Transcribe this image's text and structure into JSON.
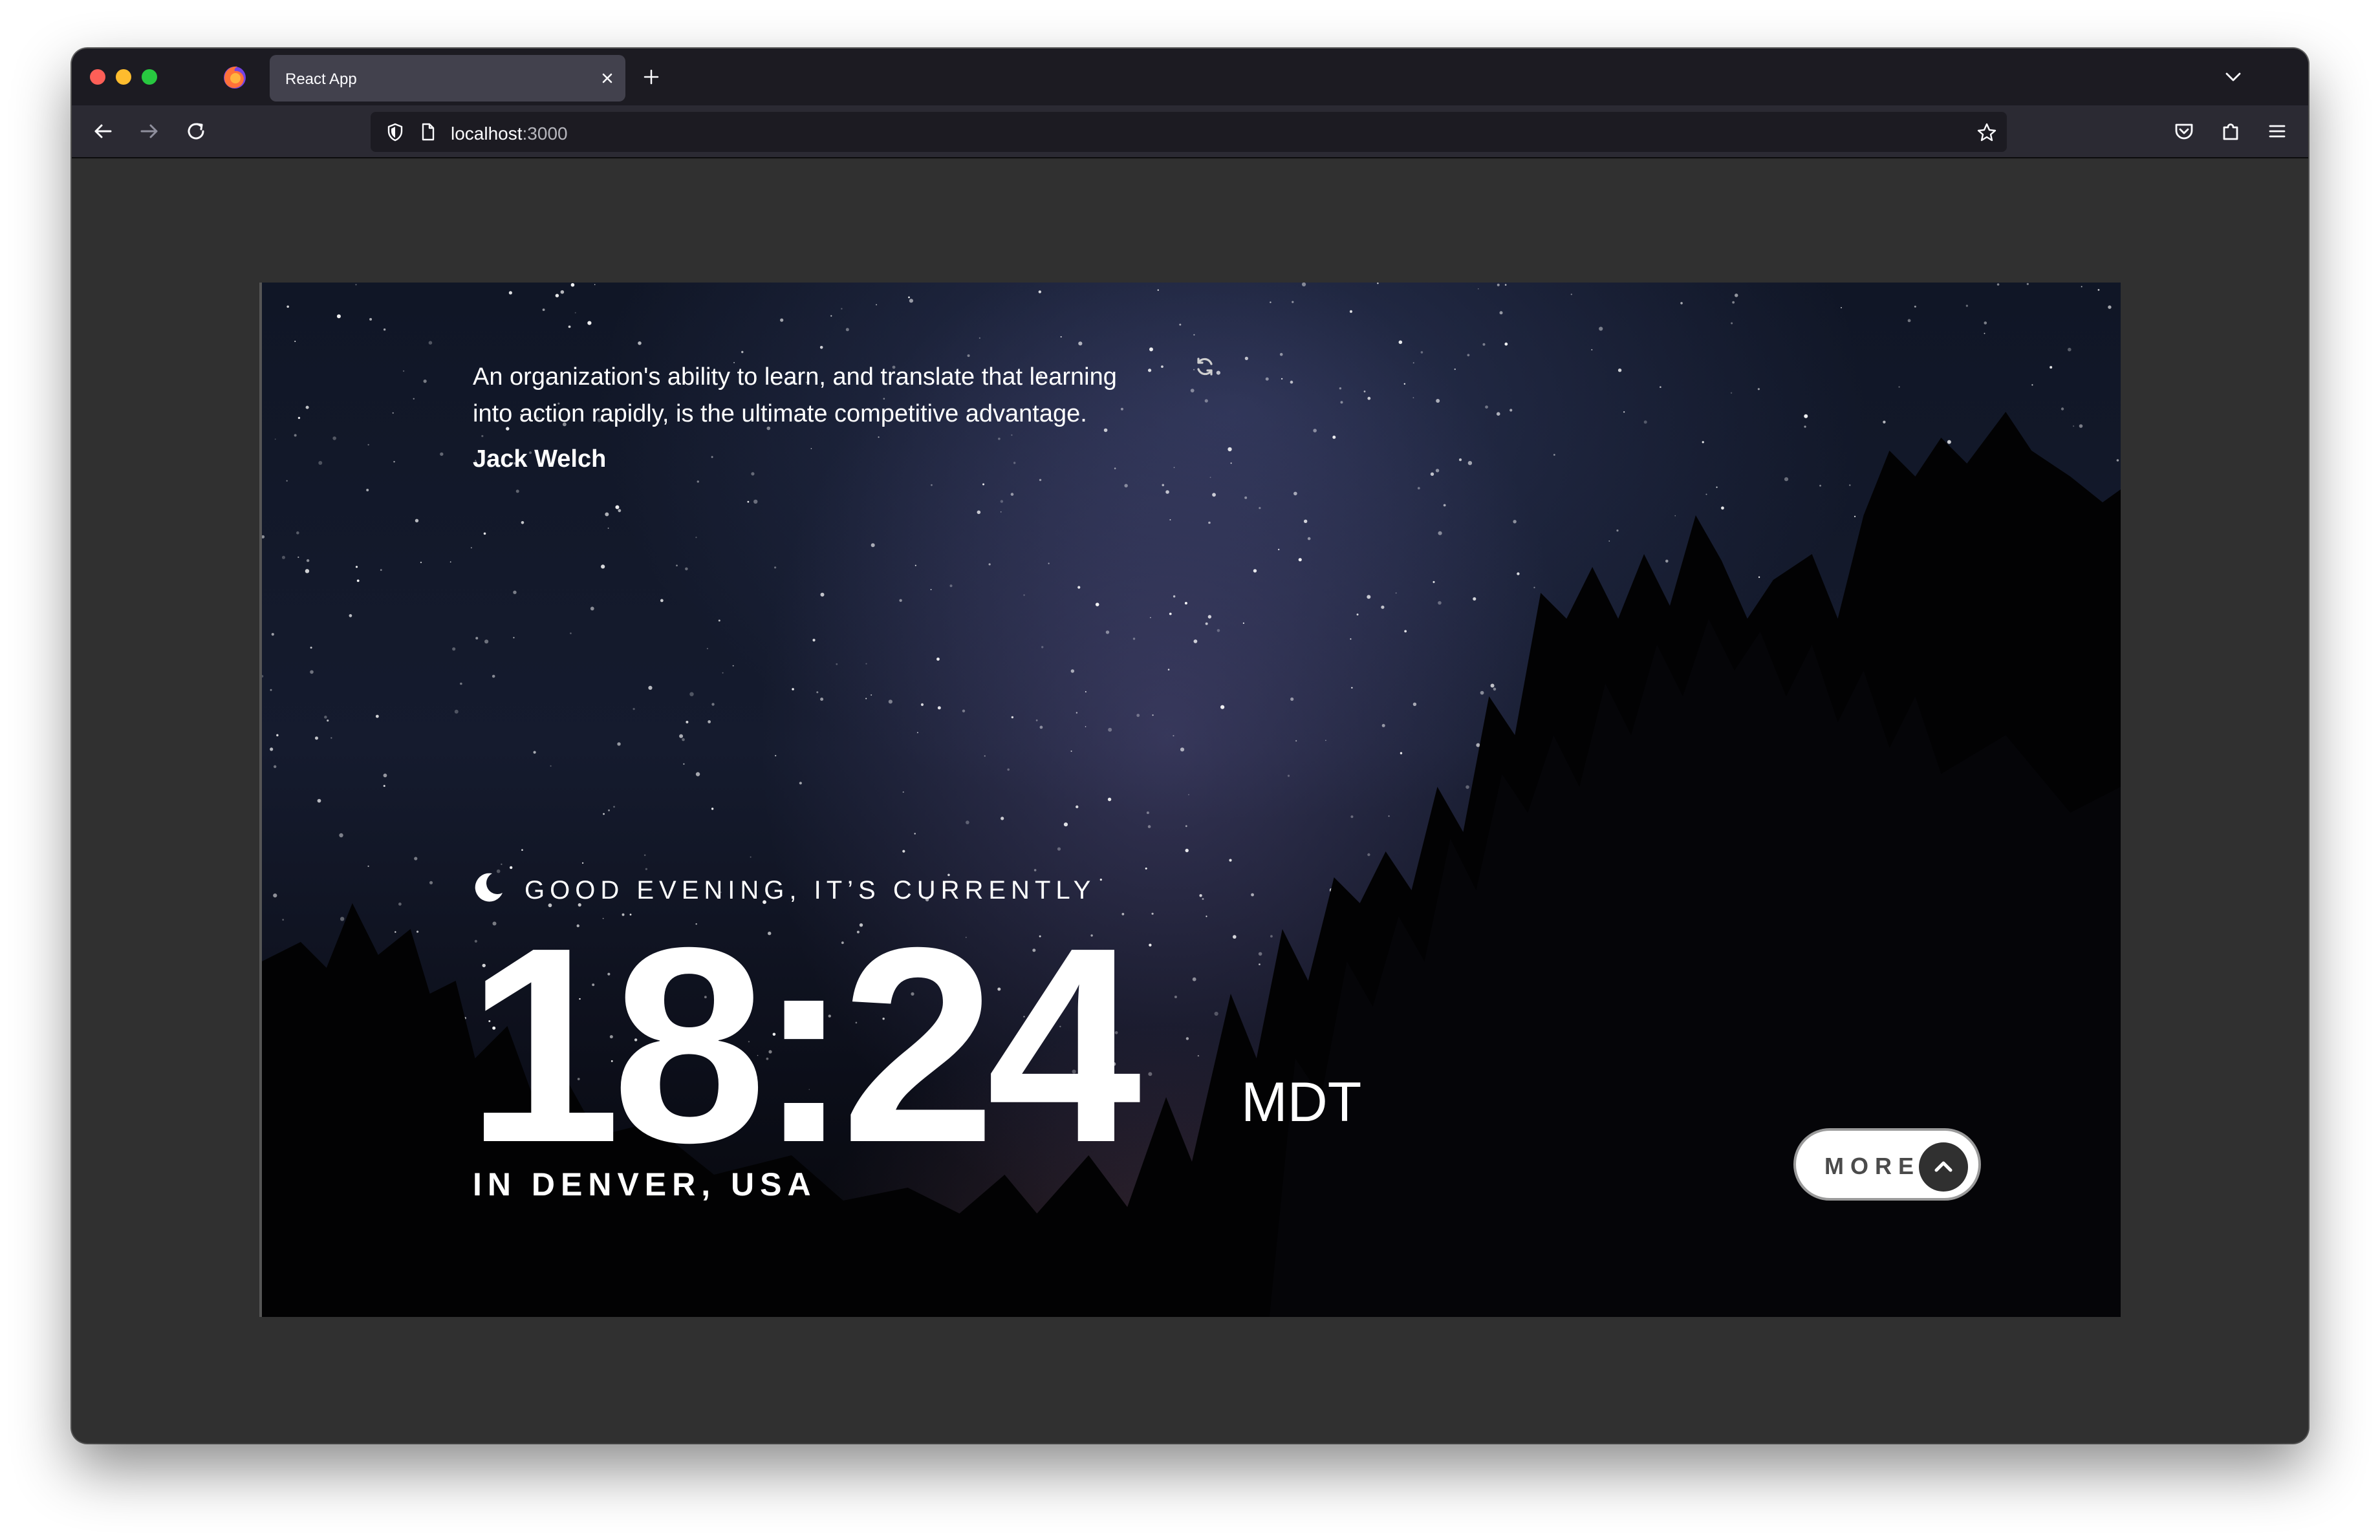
{
  "browser": {
    "tab_title": "React App",
    "url_host": "localhost",
    "url_port": ":3000"
  },
  "app": {
    "quote": "An organization's ability to learn, and translate that learning into action rapidly, is the ultimate competitive advantage.",
    "author": "Jack Welch",
    "greeting": "GOOD EVENING, IT’S CURRENTLY",
    "time": "18:24",
    "timezone": "MDT",
    "location": "IN DENVER, USA",
    "more_label": "MORE"
  },
  "colors": {
    "window_bg": "#2f2f2f",
    "button_bg": "#ffffff",
    "arrow_bg": "#303030"
  }
}
